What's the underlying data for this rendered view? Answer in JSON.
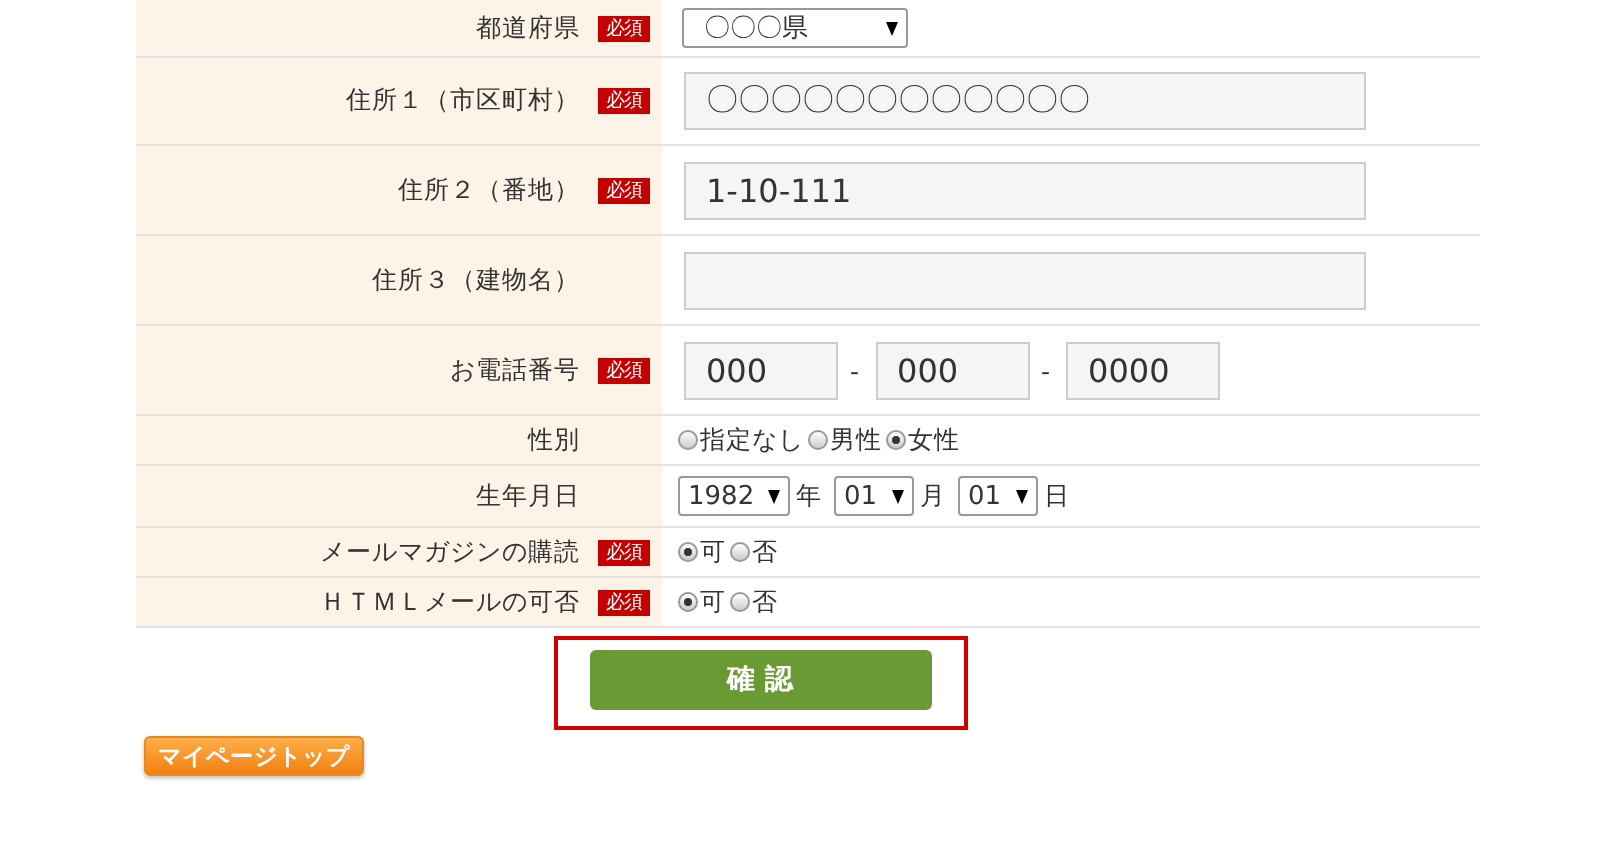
{
  "form_rows": [
    {
      "label": "都道府県",
      "badge": "必須",
      "kind": "select",
      "value": "〇〇〇県"
    },
    {
      "label": "住所１（市区町村）",
      "badge": "必須",
      "kind": "text",
      "value": "〇〇〇〇〇〇〇〇〇〇〇〇"
    },
    {
      "label": "住所２（番地）",
      "badge": "必須",
      "kind": "text",
      "value": "1-10-111"
    },
    {
      "label": "住所３（建物名）",
      "kind": "text",
      "value": ""
    },
    {
      "label": "お電話番号",
      "badge": "必須",
      "kind": "phone",
      "parts": [
        "000",
        "000",
        "0000"
      ],
      "separator": "-"
    },
    {
      "label": "性別",
      "kind": "radio",
      "options": [
        {
          "label": "指定なし",
          "selected": false
        },
        {
          "label": "男性",
          "selected": false
        },
        {
          "label": "女性",
          "selected": true
        }
      ]
    },
    {
      "label": "生年月日",
      "kind": "date",
      "fields": [
        {
          "value": "1982",
          "unit": "年"
        },
        {
          "value": "01",
          "unit": "月"
        },
        {
          "value": "01",
          "unit": "日"
        }
      ]
    },
    {
      "label": "メールマガジンの購読",
      "badge": "必須",
      "kind": "radio",
      "options": [
        {
          "label": "可",
          "selected": true
        },
        {
          "label": "否",
          "selected": false
        }
      ]
    },
    {
      "label": "ＨＴＭＬメールの可否",
      "badge": "必須",
      "kind": "radio",
      "options": [
        {
          "label": "可",
          "selected": true
        },
        {
          "label": "否",
          "selected": false
        }
      ]
    }
  ],
  "confirm_button": "確 認",
  "mypage_button": "マイページトップ"
}
